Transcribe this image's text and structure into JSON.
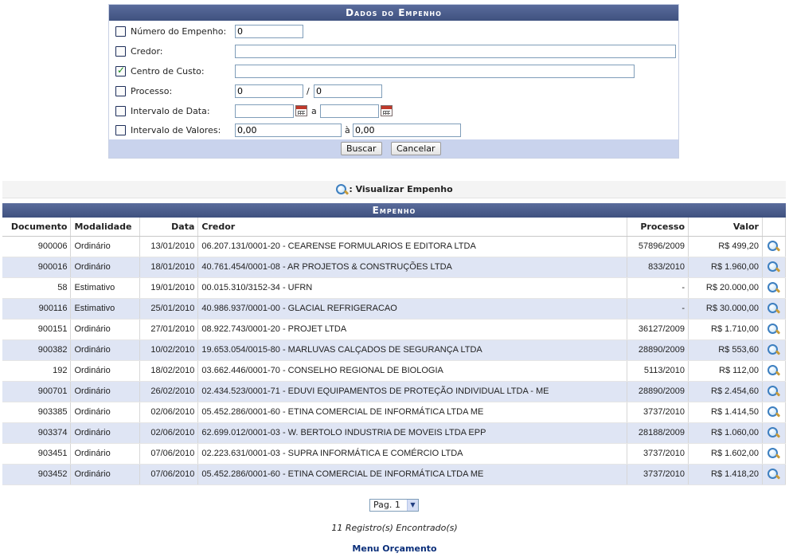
{
  "form": {
    "title": "Dados do Empenho",
    "numero": {
      "label": "Número do Empenho:",
      "value": "0"
    },
    "credor": {
      "label": "Credor:",
      "value": ""
    },
    "centro": {
      "label": "Centro de Custo:",
      "value": ""
    },
    "processo": {
      "label": "Processo:",
      "value1": "0",
      "sep": "/",
      "value2": "0"
    },
    "data": {
      "label": "Intervalo de Data:",
      "value1": "",
      "sep": "a",
      "value2": ""
    },
    "valores": {
      "label": "Intervalo de Valores:",
      "value1": "0,00",
      "sep": "à",
      "value2": "0,00"
    },
    "buscar": "Buscar",
    "cancelar": "Cancelar"
  },
  "legend": {
    "text": ": Visualizar Empenho"
  },
  "table": {
    "caption": "Empenho",
    "columns": [
      "Documento",
      "Modalidade",
      "Data",
      "Credor",
      "Processo",
      "Valor"
    ],
    "rows": [
      [
        "900006",
        "Ordinário",
        "13/01/2010",
        "06.207.131/0001-20 - CEARENSE FORMULARIOS E EDITORA LTDA",
        "57896/2009",
        "R$ 499,20"
      ],
      [
        "900016",
        "Ordinário",
        "18/01/2010",
        "40.761.454/0001-08 - AR PROJETOS & CONSTRUÇÕES LTDA",
        "833/2010",
        "R$ 1.960,00"
      ],
      [
        "58",
        "Estimativo",
        "19/01/2010",
        "00.015.310/3152-34 - UFRN",
        "-",
        "R$ 20.000,00"
      ],
      [
        "900116",
        "Estimativo",
        "25/01/2010",
        "40.986.937/0001-00 - GLACIAL REFRIGERACAO",
        "-",
        "R$ 30.000,00"
      ],
      [
        "900151",
        "Ordinário",
        "27/01/2010",
        "08.922.743/0001-20 - PROJET LTDA",
        "36127/2009",
        "R$ 1.710,00"
      ],
      [
        "900382",
        "Ordinário",
        "10/02/2010",
        "19.653.054/0015-80 - MARLUVAS CALÇADOS DE SEGURANÇA LTDA",
        "28890/2009",
        "R$ 553,60"
      ],
      [
        "192",
        "Ordinário",
        "18/02/2010",
        "03.662.446/0001-70 - CONSELHO REGIONAL DE BIOLOGIA",
        "5113/2010",
        "R$ 112,00"
      ],
      [
        "900701",
        "Ordinário",
        "26/02/2010",
        "02.434.523/0001-71 - EDUVI EQUIPAMENTOS DE PROTEÇÃO INDIVIDUAL LTDA - ME",
        "28890/2009",
        "R$ 2.454,60"
      ],
      [
        "903385",
        "Ordinário",
        "02/06/2010",
        "05.452.286/0001-60 - ETINA COMERCIAL DE INFORMÁTICA LTDA ME",
        "3737/2010",
        "R$ 1.414,50"
      ],
      [
        "903374",
        "Ordinário",
        "02/06/2010",
        "62.699.012/0001-03 - W. BERTOLO INDUSTRIA DE MOVEIS LTDA EPP",
        "28188/2009",
        "R$ 1.060,00"
      ],
      [
        "903451",
        "Ordinário",
        "07/06/2010",
        "02.223.631/0001-03 - SUPRA INFORMÁTICA E COMÉRCIO LTDA",
        "3737/2010",
        "R$ 1.602,00"
      ],
      [
        "903452",
        "Ordinário",
        "07/06/2010",
        "05.452.286/0001-60 - ETINA COMERCIAL DE INFORMÁTICA LTDA ME",
        "3737/2010",
        "R$ 1.418,20"
      ]
    ]
  },
  "pager": {
    "selected": "Pag. 1"
  },
  "footer": {
    "count": "11 Registro(s) Encontrado(s)",
    "menu": "Menu Orçamento"
  }
}
